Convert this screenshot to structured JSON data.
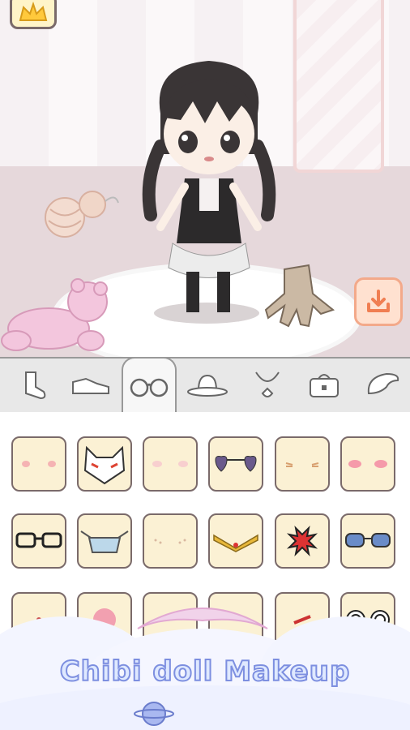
{
  "app": {
    "title": "Chibi doll Makeup"
  },
  "colors": {
    "accent_download": "#f3a98a",
    "cell_bg": "#fbf1d4",
    "title_fill": "#dfe9ff",
    "title_stroke": "#7d8fe0"
  },
  "tabs": [
    {
      "name": "socks-tab",
      "icon": "socks-icon",
      "active": false
    },
    {
      "name": "shoes-tab",
      "icon": "shoe-icon",
      "active": false
    },
    {
      "name": "glasses-tab",
      "icon": "glasses-icon",
      "active": true
    },
    {
      "name": "hat-tab",
      "icon": "hat-icon",
      "active": false
    },
    {
      "name": "necklace-tab",
      "icon": "necklace-icon",
      "active": false
    },
    {
      "name": "bag-tab",
      "icon": "bag-icon",
      "active": false
    },
    {
      "name": "wings-tab",
      "icon": "wing-icon",
      "active": false
    }
  ],
  "items": [
    [
      "blush-dots",
      "fox-mask",
      "light-blush",
      "heart-sunglasses",
      "whisker-marks",
      "pink-blush"
    ],
    [
      "black-glasses",
      "face-mask",
      "freckles",
      "gold-tiara",
      "anger-mark",
      "blue-sunglasses"
    ],
    [
      "cheek-mark",
      "pink-ball",
      "gold-accessory",
      "small-mark",
      "red-mark",
      "swirl-glasses"
    ]
  ]
}
